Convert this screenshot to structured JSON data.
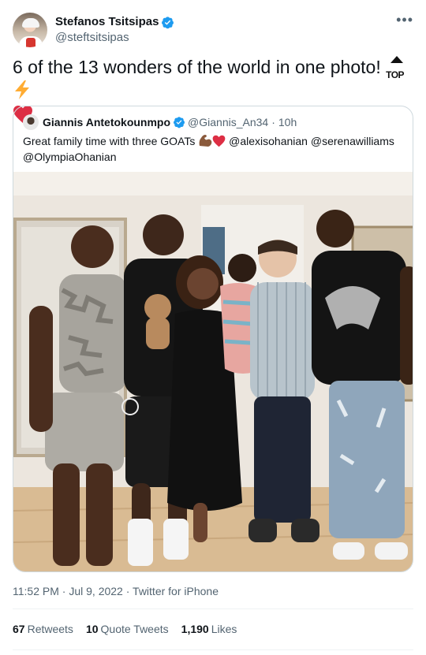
{
  "author": {
    "name": "Stefanos Tsitsipas",
    "handle": "@steftsitsipas"
  },
  "icons": {
    "verified": "verified-badge-icon",
    "more": "more-options-icon",
    "top": "top-arrow-emoji",
    "bolt": "high-voltage-emoji",
    "heart": "red-heart-emoji",
    "flexed": "flexed-biceps-emoji"
  },
  "tweet": {
    "text": "6 of the 13 wonders of the world in one photo! ",
    "top_emoji_text": "TOP"
  },
  "quote": {
    "name": "Giannis Antetokounmpo",
    "handle": "@Giannis_An34",
    "dot": "·",
    "time": "10h",
    "text_start": "Great family time with three GOATs ",
    "text_end": " @alexisohanian @serenawilliams @OlympiaOhanian"
  },
  "meta": {
    "time": "11:52 PM",
    "dot1": "·",
    "date": "Jul 9, 2022",
    "dot2": "·",
    "source": "Twitter for iPhone"
  },
  "stats": {
    "retweets_count": "67",
    "retweets_label": "Retweets",
    "quotes_count": "10",
    "quotes_label": "Quote Tweets",
    "likes_count": "1,190",
    "likes_label": "Likes"
  },
  "colors": {
    "verified_blue": "#1d9bf0",
    "secondary_text": "#536471",
    "border": "#cfd9de",
    "heart_red": "#dd2e44",
    "bolt_yellow": "#ffac33"
  }
}
